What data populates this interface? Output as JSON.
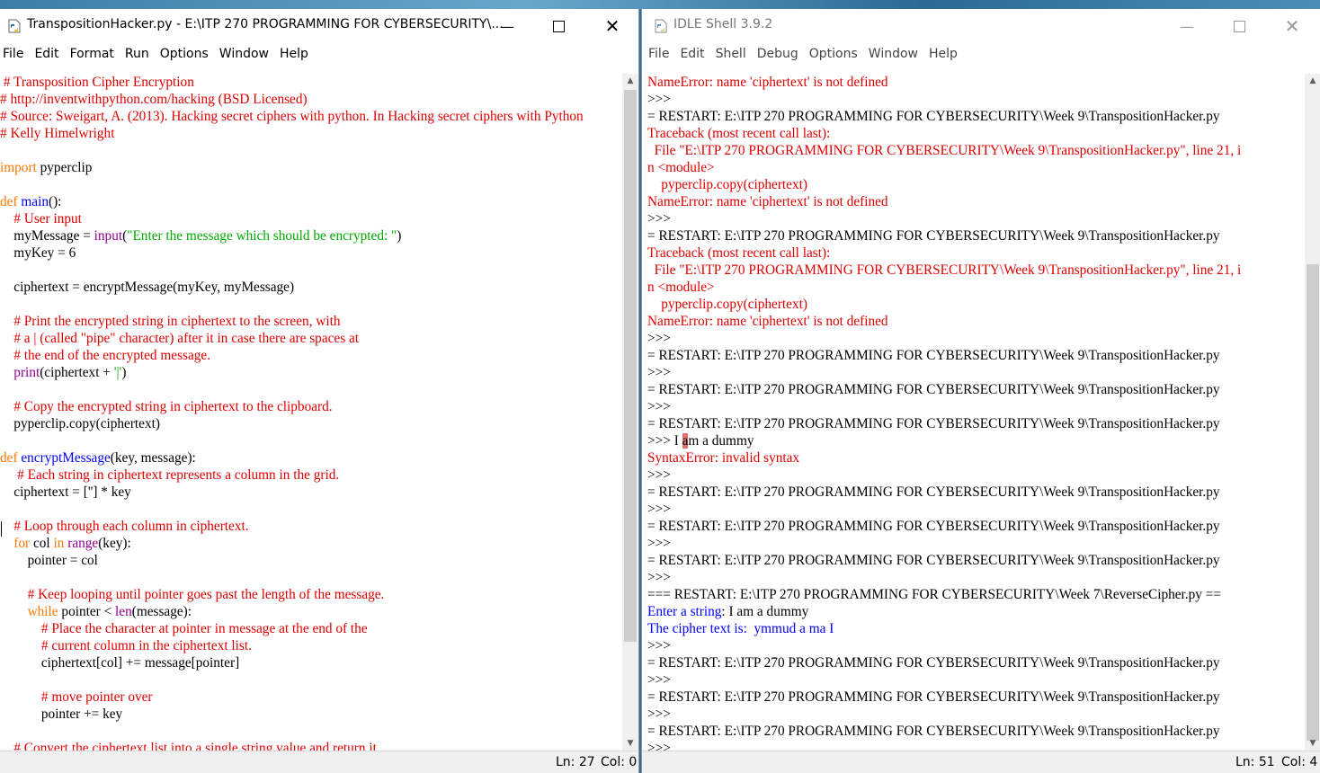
{
  "colors": {
    "comment": "#dd0000",
    "keyword": "#ff7700",
    "builtin": "#900090",
    "definition": "#0000ff",
    "string": "#00aa00",
    "normal": "#000000",
    "error": "#dd0000",
    "stdout": "#0000ff",
    "prompt": "#770000"
  },
  "editor": {
    "title": "TranspositionHacker.py - E:\\ITP 270 PROGRAMMING FOR CYBERSECURITY\\...",
    "icon": "python-file-icon",
    "menu": [
      "File",
      "Edit",
      "Format",
      "Run",
      "Options",
      "Window",
      "Help"
    ],
    "lines": [
      [
        [
          " # Transposition Cipher Encryption",
          "comment"
        ]
      ],
      [
        [
          "# http://inventwithpython.com/hacking (BSD Licensed)",
          "comment"
        ]
      ],
      [
        [
          "# Source: Sweigart, A. (2013). Hacking secret ciphers with python. In Hacking secret ciphers with Python",
          "comment"
        ]
      ],
      [
        [
          "# Kelly Himelwright",
          "comment"
        ]
      ],
      [],
      [
        [
          "import",
          "keyword"
        ],
        [
          " pyperclip",
          "normal"
        ]
      ],
      [],
      [
        [
          "def",
          "keyword"
        ],
        [
          " ",
          "normal"
        ],
        [
          "main",
          "definition"
        ],
        [
          "():",
          "normal"
        ]
      ],
      [
        [
          "    # User input",
          "comment"
        ]
      ],
      [
        [
          "    myMessage = ",
          "normal"
        ],
        [
          "input",
          "builtin"
        ],
        [
          "(",
          "normal"
        ],
        [
          "\"Enter the message which should be encrypted: \"",
          "string"
        ],
        [
          ")",
          "normal"
        ]
      ],
      [
        [
          "    myKey = 6",
          "normal"
        ]
      ],
      [],
      [
        [
          "    ciphertext = encryptMessage(myKey, myMessage)",
          "normal"
        ]
      ],
      [],
      [
        [
          "    # Print the encrypted string in ciphertext to the screen, with",
          "comment"
        ]
      ],
      [
        [
          "    # a | (called \"pipe\" character) after it in case there are spaces at",
          "comment"
        ]
      ],
      [
        [
          "    # the end of the encrypted message.",
          "comment"
        ]
      ],
      [
        [
          "    ",
          "normal"
        ],
        [
          "print",
          "builtin"
        ],
        [
          "(ciphertext + ",
          "normal"
        ],
        [
          "'|'",
          "string"
        ],
        [
          ")",
          "normal"
        ]
      ],
      [],
      [
        [
          "    # Copy the encrypted string in ciphertext to the clipboard.",
          "comment"
        ]
      ],
      [
        [
          "    pyperclip.copy(ciphertext)",
          "normal"
        ]
      ],
      [],
      [
        [
          "def",
          "keyword"
        ],
        [
          " ",
          "normal"
        ],
        [
          "encryptMessage",
          "definition"
        ],
        [
          "(key, message):",
          "normal"
        ]
      ],
      [
        [
          "     # Each string in ciphertext represents a column in the grid.",
          "comment"
        ]
      ],
      [
        [
          "    ciphertext = [''] * key",
          "normal"
        ]
      ],
      [],
      [
        [
          "    # Loop through each column in ciphertext.",
          "comment"
        ]
      ],
      [
        [
          "    ",
          "normal"
        ],
        [
          "for",
          "keyword"
        ],
        [
          " col ",
          "normal"
        ],
        [
          "in",
          "keyword"
        ],
        [
          " ",
          "normal"
        ],
        [
          "range",
          "builtin"
        ],
        [
          "(key):",
          "normal"
        ]
      ],
      [
        [
          "        pointer = col",
          "normal"
        ]
      ],
      [],
      [
        [
          "        # Keep looping until pointer goes past the length of the message.",
          "comment"
        ]
      ],
      [
        [
          "        ",
          "normal"
        ],
        [
          "while",
          "keyword"
        ],
        [
          " pointer < ",
          "normal"
        ],
        [
          "len",
          "builtin"
        ],
        [
          "(message):",
          "normal"
        ]
      ],
      [
        [
          "            # Place the character at pointer in message at the end of the",
          "comment"
        ]
      ],
      [
        [
          "            # current column in the ciphertext list.",
          "comment"
        ]
      ],
      [
        [
          "            ciphertext[col] += message[pointer]",
          "normal"
        ]
      ],
      [],
      [
        [
          "            # move pointer over",
          "comment"
        ]
      ],
      [
        [
          "            pointer += key",
          "normal"
        ]
      ],
      [],
      [
        [
          "    # Convert the ciphertext list into a single string value and return it.",
          "comment"
        ]
      ]
    ],
    "status": {
      "line": "Ln: 27",
      "col": "Col: 0"
    }
  },
  "shell": {
    "title": "IDLE Shell 3.9.2",
    "icon": "idle-shell-icon",
    "menu": [
      "File",
      "Edit",
      "Shell",
      "Debug",
      "Options",
      "Window",
      "Help"
    ],
    "lines": [
      [
        [
          "NameError: name 'ciphertext' is not defined",
          "error"
        ]
      ],
      [
        [
          ">>> ",
          "normal"
        ]
      ],
      [
        [
          "= RESTART: E:\\ITP 270 PROGRAMMING FOR CYBERSECURITY\\Week 9\\TranspositionHacker.py",
          "normal"
        ]
      ],
      [
        [
          "Traceback (most recent call last):",
          "error"
        ]
      ],
      [
        [
          "  File \"E:\\ITP 270 PROGRAMMING FOR CYBERSECURITY\\Week 9\\TranspositionHacker.py\", line 21, i",
          "error"
        ]
      ],
      [
        [
          "n <module>",
          "error"
        ]
      ],
      [
        [
          "    pyperclip.copy(ciphertext)",
          "error"
        ]
      ],
      [
        [
          "NameError: name 'ciphertext' is not defined",
          "error"
        ]
      ],
      [
        [
          ">>> ",
          "normal"
        ]
      ],
      [
        [
          "= RESTART: E:\\ITP 270 PROGRAMMING FOR CYBERSECURITY\\Week 9\\TranspositionHacker.py",
          "normal"
        ]
      ],
      [
        [
          "Traceback (most recent call last):",
          "error"
        ]
      ],
      [
        [
          "  File \"E:\\ITP 270 PROGRAMMING FOR CYBERSECURITY\\Week 9\\TranspositionHacker.py\", line 21, i",
          "error"
        ]
      ],
      [
        [
          "n <module>",
          "error"
        ]
      ],
      [
        [
          "    pyperclip.copy(ciphertext)",
          "error"
        ]
      ],
      [
        [
          "NameError: name 'ciphertext' is not defined",
          "error"
        ]
      ],
      [
        [
          ">>> ",
          "normal"
        ]
      ],
      [
        [
          "= RESTART: E:\\ITP 270 PROGRAMMING FOR CYBERSECURITY\\Week 9\\TranspositionHacker.py",
          "normal"
        ]
      ],
      [
        [
          ">>> ",
          "normal"
        ]
      ],
      [
        [
          "= RESTART: E:\\ITP 270 PROGRAMMING FOR CYBERSECURITY\\Week 9\\TranspositionHacker.py",
          "normal"
        ]
      ],
      [
        [
          ">>> ",
          "normal"
        ]
      ],
      [
        [
          "= RESTART: E:\\ITP 270 PROGRAMMING FOR CYBERSECURITY\\Week 9\\TranspositionHacker.py",
          "normal"
        ]
      ],
      [
        [
          ">>> I ",
          "normal"
        ],
        [
          "a",
          "highlight"
        ],
        [
          "m a dummy",
          "normal"
        ]
      ],
      [
        [
          "SyntaxError: invalid syntax",
          "error"
        ]
      ],
      [
        [
          ">>> ",
          "normal"
        ]
      ],
      [
        [
          "= RESTART: E:\\ITP 270 PROGRAMMING FOR CYBERSECURITY\\Week 9\\TranspositionHacker.py",
          "normal"
        ]
      ],
      [
        [
          ">>> ",
          "normal"
        ]
      ],
      [
        [
          "= RESTART: E:\\ITP 270 PROGRAMMING FOR CYBERSECURITY\\Week 9\\TranspositionHacker.py",
          "normal"
        ]
      ],
      [
        [
          ">>> ",
          "normal"
        ]
      ],
      [
        [
          "= RESTART: E:\\ITP 270 PROGRAMMING FOR CYBERSECURITY\\Week 9\\TranspositionHacker.py",
          "normal"
        ]
      ],
      [
        [
          ">>> ",
          "normal"
        ]
      ],
      [
        [
          "=== RESTART: E:\\ITP 270 PROGRAMMING FOR CYBERSECURITY\\Week 7\\ReverseCipher.py ==",
          "normal"
        ]
      ],
      [
        [
          "Enter a string",
          "stdout"
        ],
        [
          ": I am a dummy",
          "normal"
        ]
      ],
      [
        [
          "The cipher text is:  ymmud a ma I",
          "stdout"
        ]
      ],
      [
        [
          ">>> ",
          "normal"
        ]
      ],
      [
        [
          "= RESTART: E:\\ITP 270 PROGRAMMING FOR CYBERSECURITY\\Week 9\\TranspositionHacker.py",
          "normal"
        ]
      ],
      [
        [
          ">>> ",
          "normal"
        ]
      ],
      [
        [
          "= RESTART: E:\\ITP 270 PROGRAMMING FOR CYBERSECURITY\\Week 9\\TranspositionHacker.py",
          "normal"
        ]
      ],
      [
        [
          ">>> ",
          "normal"
        ]
      ],
      [
        [
          "= RESTART: E:\\ITP 270 PROGRAMMING FOR CYBERSECURITY\\Week 9\\TranspositionHacker.py",
          "normal"
        ]
      ],
      [
        [
          ">>> ",
          "normal"
        ]
      ]
    ],
    "status": {
      "line": "Ln: 51",
      "col": "Col: 4"
    }
  }
}
